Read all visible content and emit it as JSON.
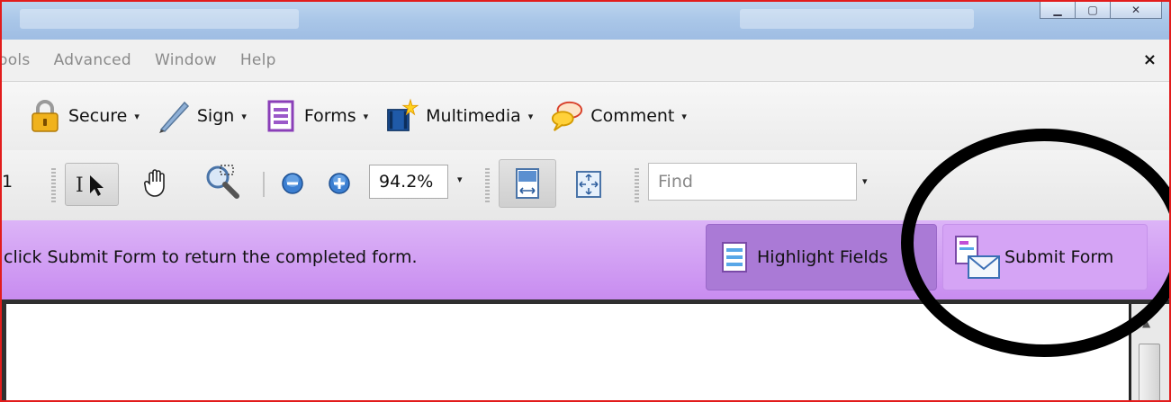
{
  "menubar": {
    "items": [
      "ools",
      "Advanced",
      "Window",
      "Help"
    ],
    "close_glyph": "×"
  },
  "toolbar": {
    "secure": "Secure",
    "sign": "Sign",
    "forms": "Forms",
    "multimedia": "Multimedia",
    "comment": "Comment",
    "caret": "▾"
  },
  "viewbar": {
    "page_number": "1",
    "zoom": "94.2%",
    "find_placeholder": "Find"
  },
  "formbar": {
    "message": "click Submit Form to return the completed form.",
    "highlight_label": "Highlight Fields",
    "submit_label": "Submit Form",
    "background": "#c88cf0"
  },
  "icons": {
    "secure": "lock-icon",
    "sign": "pen-icon",
    "forms": "form-icon",
    "multimedia": "film-star-icon",
    "comment": "speech-bubble-icon",
    "select": "select-cursor-icon",
    "hand": "hand-icon",
    "marquee_zoom": "marquee-zoom-icon",
    "zoom_out": "zoom-out-icon",
    "zoom_in": "zoom-in-icon",
    "fit_width": "fit-width-icon",
    "fit_page": "fit-page-icon",
    "submit": "submit-envelope-icon"
  },
  "colors": {
    "frame": "#e21c1c",
    "annotation": "#000000"
  }
}
